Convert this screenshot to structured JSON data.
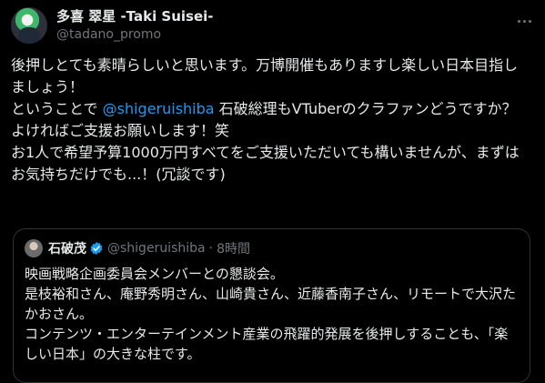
{
  "author": {
    "display_name": "多喜 翠星 -Taki Suisei-",
    "handle": "@tadano_promo"
  },
  "tweet": {
    "line1": "後押しとても素晴らしいと思います。万博開催もありますし楽しい日本目指しましょう！",
    "line2_before": "ということで ",
    "mention": "@shigeruishiba",
    "line2_after": " 石破総理もVTuberのクラファンどうですか？",
    "line3": "よければご支援お願いします！笑",
    "line4": "お1人で希望予算1000万円すべてをご支援いただいても構いませんが、まずはお気持ちだけでも...！(冗談です)"
  },
  "quoted_tweet": {
    "display_name": "石破茂",
    "handle": "@shigeruishiba",
    "separator": "·",
    "time": "8時間",
    "text": "映画戦略企画委員会メンバーとの懇談会。\n是枝裕和さん、庵野秀明さん、山崎貴さん、近藤香南子さん、リモートで大沢たかおさん。\nコンテンツ・エンターテインメント産業の飛躍的発展を後押しすることも、「楽しい日本」の大きな柱です。",
    "verified_color": "#1d9bf0"
  },
  "colors": {
    "background": "#000000",
    "text": "#e7e9ea",
    "secondary": "#71767b",
    "link": "#1d9bf0",
    "border": "#2f3336"
  }
}
